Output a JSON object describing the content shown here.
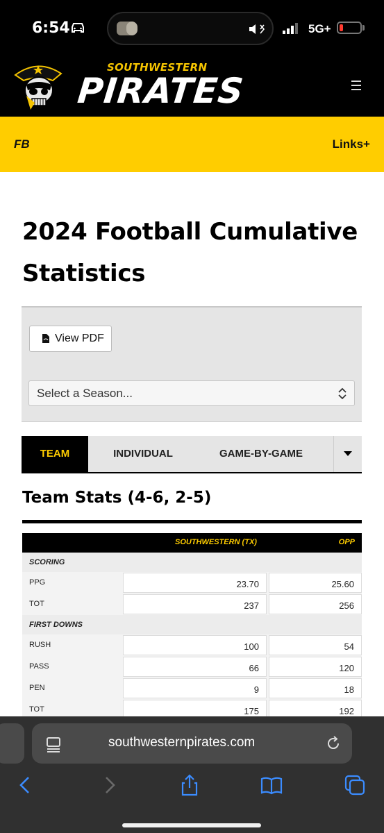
{
  "status": {
    "time": "6:54",
    "network": "5G+",
    "colors": {
      "battery_low": "#ff3b30"
    }
  },
  "header": {
    "logo_top": "SOUTHWESTERN",
    "logo_main": "PIRATES",
    "menu_icon": "hamburger-menu-icon"
  },
  "subnav": {
    "sport": "FB",
    "links": "Links+"
  },
  "page": {
    "title": "2024 Football Cumulative Statistics",
    "pdf_button": "View PDF",
    "season_select": "Select a Season..."
  },
  "tabs": [
    {
      "label": "TEAM",
      "active": true
    },
    {
      "label": "INDIVIDUAL",
      "active": false
    },
    {
      "label": "GAME-BY-GAME",
      "active": false
    }
  ],
  "team_stats": {
    "title": "Team Stats (4-6, 2-5)",
    "columns": [
      "SOUTHWESTERN (TX)",
      "OPP"
    ],
    "groups": [
      {
        "name": "SCORING",
        "rows": [
          {
            "label": "PPG",
            "sw": "23.70",
            "opp": "25.60"
          },
          {
            "label": "TOT",
            "sw": "237",
            "opp": "256"
          }
        ]
      },
      {
        "name": "FIRST DOWNS",
        "rows": [
          {
            "label": "RUSH",
            "sw": "100",
            "opp": "54"
          },
          {
            "label": "PASS",
            "sw": "66",
            "opp": "120"
          },
          {
            "label": "PEN",
            "sw": "9",
            "opp": "18"
          },
          {
            "label": "TOT",
            "sw": "175",
            "opp": "192"
          }
        ]
      }
    ]
  },
  "browser": {
    "url": "southwesternpirates.com"
  },
  "colors": {
    "brand_yellow": "#ffcd00",
    "brand_black": "#000000"
  }
}
